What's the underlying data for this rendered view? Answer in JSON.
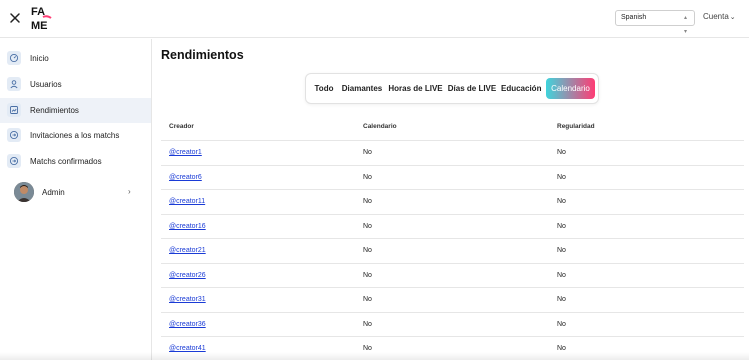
{
  "header": {
    "close_icon": "close-icon",
    "logo_icon": "fame-logo",
    "language_select": {
      "value": "Spanish"
    },
    "account_label": "Cuenta"
  },
  "sidebar": {
    "items": [
      {
        "label": "Inicio",
        "icon": "dashboard-icon"
      },
      {
        "label": "Usuarios",
        "icon": "user-icon"
      },
      {
        "label": "Rendimientos",
        "icon": "chart-icon"
      },
      {
        "label": "Invitaciones a los matchs",
        "icon": "invite-icon"
      },
      {
        "label": "Matchs confirmados",
        "icon": "confirmed-icon"
      }
    ],
    "active_index": 2,
    "admin": {
      "label": "Admin"
    }
  },
  "main": {
    "title": "Rendimientos",
    "tabs": [
      {
        "label": "Todo"
      },
      {
        "label": "Diamantes"
      },
      {
        "label": "Horas de LIVE"
      },
      {
        "label": "Días de LIVE"
      },
      {
        "label": "Educación"
      },
      {
        "label": "Calendario"
      }
    ],
    "active_tab": 5,
    "table": {
      "columns": [
        "Creador",
        "Calendario",
        "Regularidad"
      ],
      "rows": [
        {
          "creator": "@creator1",
          "calendario": "No",
          "regularidad": "No"
        },
        {
          "creator": "@creator6",
          "calendario": "No",
          "regularidad": "No"
        },
        {
          "creator": "@creator11",
          "calendario": "No",
          "regularidad": "No"
        },
        {
          "creator": "@creator16",
          "calendario": "No",
          "regularidad": "No"
        },
        {
          "creator": "@creator21",
          "calendario": "No",
          "regularidad": "No"
        },
        {
          "creator": "@creator26",
          "calendario": "No",
          "regularidad": "No"
        },
        {
          "creator": "@creator31",
          "calendario": "No",
          "regularidad": "No"
        },
        {
          "creator": "@creator36",
          "calendario": "No",
          "regularidad": "No"
        },
        {
          "creator": "@creator41",
          "calendario": "No",
          "regularidad": "No"
        }
      ]
    }
  },
  "colors": {
    "accent_start": "#3fd4dc",
    "accent_end": "#ff3c74",
    "link": "#1a3bd6",
    "active_sidebar_bg": "#eef2f8"
  }
}
